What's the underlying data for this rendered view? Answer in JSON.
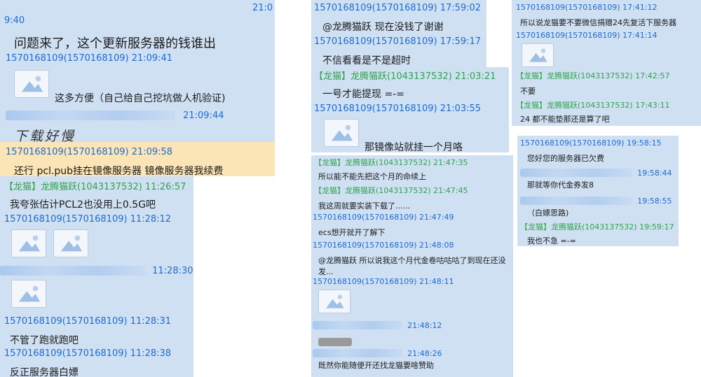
{
  "panel1": {
    "top_time": "21:0",
    "top_time_wrap": "9:40",
    "line1": "问题来了，这个更新服务器的钱谁出",
    "h1": "1570168109(1570168109) 21:09:41",
    "line2": "这多方便（自己给自己挖坑做人机验证)",
    "h2_time": "21:09:44",
    "line3": "下载好慢",
    "h3": "1570168109(1570168109) 21:09:58",
    "line4": "还行 pcl.pub挂在镜像服务器 镜像服务器我续费",
    "h4": "【龙猫】龙腾猫跃(1043137532) 11:26:57",
    "line5": "我夸张估计PCL2也没用上0.5G吧",
    "h5": "1570168109(1570168109) 11:28:12",
    "h6_time": "11:28:30",
    "h7": "1570168109(1570168109) 11:28:31",
    "line6": "不管了跑就跑吧",
    "h8": "1570168109(1570168109) 11:28:38",
    "line7": "反正服务器白嫖"
  },
  "panel2": {
    "h1": "1570168109(1570168109) 17:59:02",
    "line1": "@龙腾猫跃 现在没钱了谢谢",
    "h2": "1570168109(1570168109) 17:59:17",
    "line2": "不信看看是不是超时",
    "h3": "【龙猫】龙腾猫跃(1043137532) 21:03:21",
    "line3": "一号才能提现 =-=",
    "h4": "1570168109(1570168109) 21:03:55",
    "line4": "那镜像站就挂一个月咯"
  },
  "panel3": {
    "h1": "1570168109(1570168109) 17:41:12",
    "line1": "所以说龙猫要不要微信捐赠24先复活下服务器",
    "h2": "1570168109(1570168109) 17:41:14",
    "h3": "【龙猫】龙腾猫跃(1043137532) 17:42:57",
    "line2": "不要",
    "h4": "【龙猫】龙腾猫跃(1043137532) 17:43:11",
    "line3": "24 都不能垫那还是算了吧"
  },
  "panel4": {
    "h1": "【龙猫】龙腾猫跃(1043137532) 21:47:35",
    "line1": "所以能不能先把这个月的命续上",
    "h2": "【龙猫】龙腾猫跃(1043137532) 21:47:45",
    "line2": "我这周就要实装下载了......",
    "h3": "1570168109(1570168109) 21:47:49",
    "line3": "ecs想开就开了解下",
    "h4": "1570168109(1570168109) 21:48:08",
    "line4a": "@龙腾猫跃 所以说我这个月代金卷咕咕咕了到现在还没",
    "line4b": "发...",
    "h5": "1570168109(1570168109) 21:48:11",
    "h6_time": "21:48:12",
    "h7_time": "21:48:26",
    "line5": "既然你能随便开还找龙猫要啥赞助"
  },
  "panel5": {
    "h1": "1570168109(1570168109) 19:58:15",
    "line1": "您好您的服务器已欠费",
    "h2_time": "19:58:44",
    "line2": "那就等你代金券发8",
    "h3_time": "19:58:55",
    "line3": "（白嫖思路)",
    "h4": "【龙猫】龙腾猫跃(1043137532) 19:59:17",
    "line4": "我也不急 =-="
  },
  "colors": {
    "panel_bg": "#cfe0f3",
    "id_blue": "#1c6ccf",
    "admin_green": "#2fa44a",
    "highlight": "#fbe4b5"
  },
  "icons": {
    "image_placeholder": "image-placeholder-icon"
  }
}
